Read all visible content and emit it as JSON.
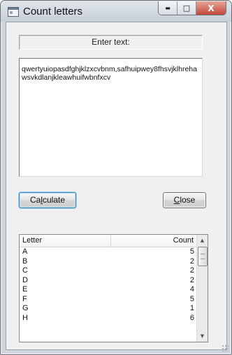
{
  "window": {
    "title": "Count letters",
    "caption": {
      "minimize": "▬",
      "maximize": "□",
      "close": "X"
    }
  },
  "prompt_label": "Enter text:",
  "input": {
    "value": "qwertyuiopasdfghjklzxcvbnm,safhuipwey8fhsvjklhrehawsvkdlanjkleawhuifwbnfxcv"
  },
  "buttons": {
    "calculate_pre": "Ca",
    "calculate_mnemonic": "l",
    "calculate_post": "culate",
    "close_mnemonic": "C",
    "close_post": "lose"
  },
  "list": {
    "columns": {
      "letter": "Letter",
      "count": "Count"
    },
    "rows": [
      {
        "letter": "A",
        "count": "5"
      },
      {
        "letter": "B",
        "count": "2"
      },
      {
        "letter": "C",
        "count": "2"
      },
      {
        "letter": "D",
        "count": "2"
      },
      {
        "letter": "E",
        "count": "4"
      },
      {
        "letter": "F",
        "count": "5"
      },
      {
        "letter": "G",
        "count": "1"
      },
      {
        "letter": "H",
        "count": "6"
      }
    ],
    "scroll_up": "▲",
    "scroll_down": "▼"
  }
}
